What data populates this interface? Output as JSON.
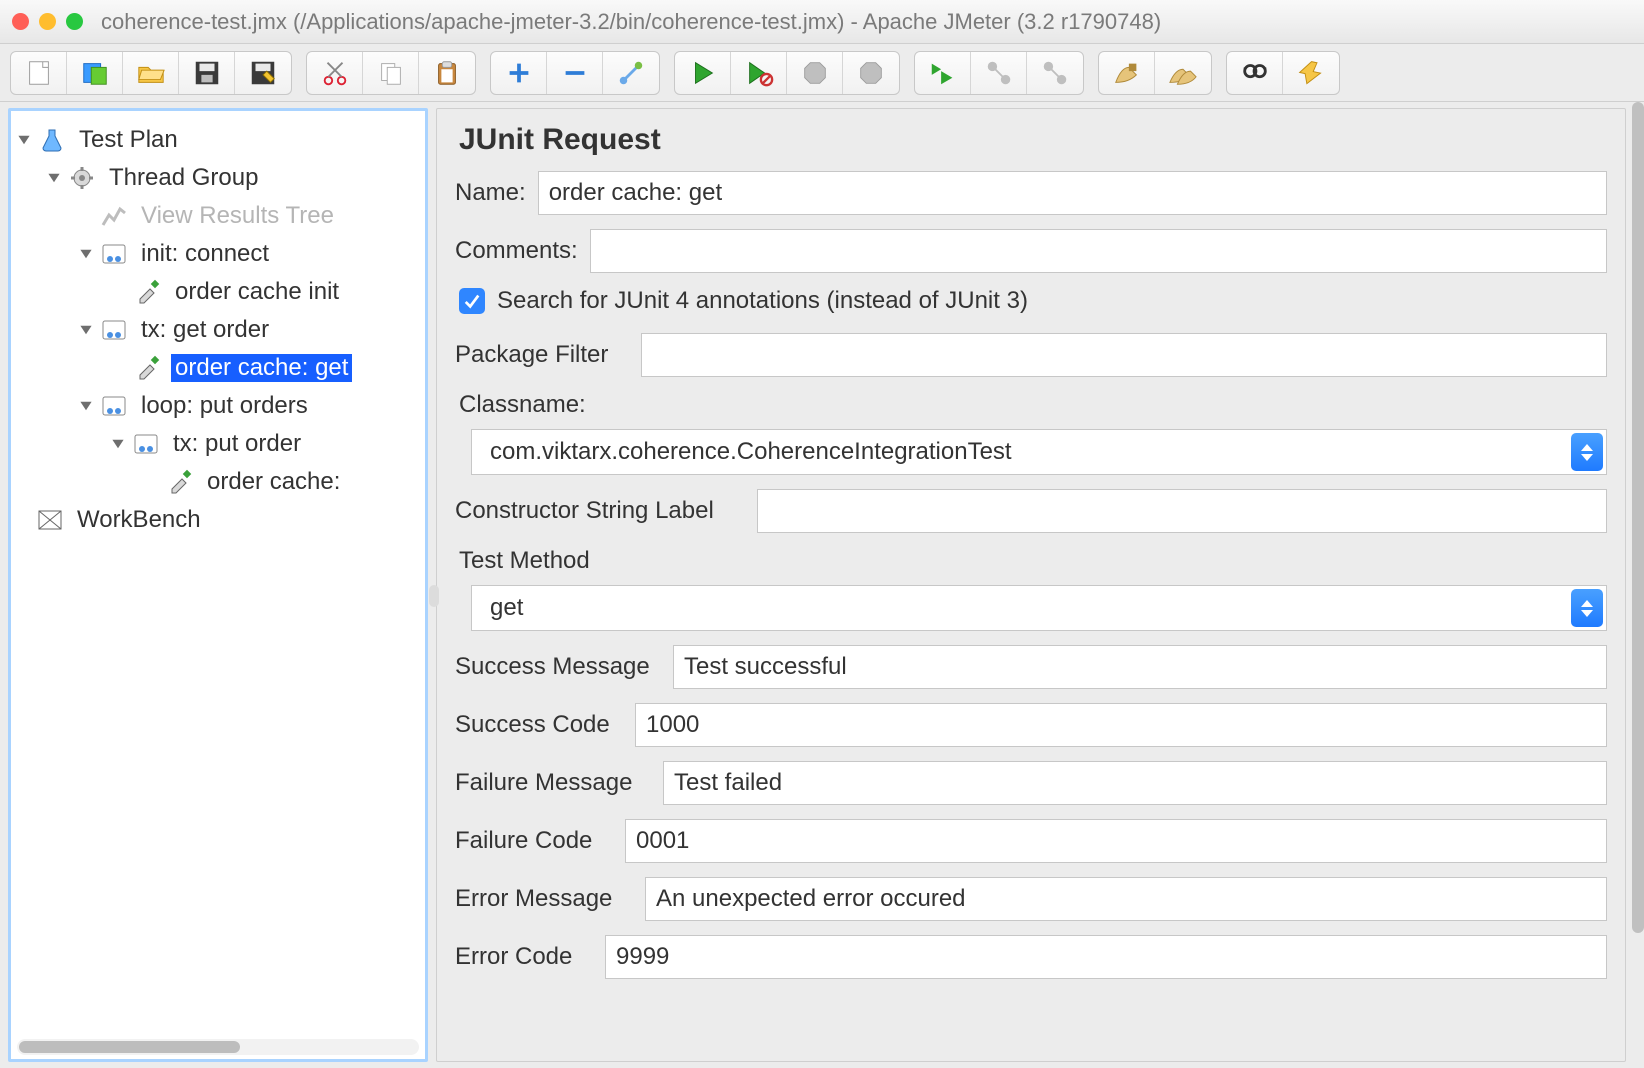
{
  "window": {
    "title": "coherence-test.jmx (/Applications/apache-jmeter-3.2/bin/coherence-test.jmx) - Apache JMeter (3.2 r1790748)"
  },
  "tree": {
    "test_plan": "Test Plan",
    "thread_group": "Thread Group",
    "view_results": "View Results Tree",
    "init_connect": "init: connect",
    "order_cache_init": "order cache init",
    "tx_get_order": "tx: get order",
    "order_cache_get": "order cache: get",
    "loop_put_orders": "loop: put orders",
    "tx_put_order": "tx: put order",
    "order_cache_put": "order cache:",
    "workbench": "WorkBench"
  },
  "panel": {
    "title": "JUnit Request",
    "name_label": "Name:",
    "name_value": "order cache: get",
    "comments_label": "Comments:",
    "comments_value": "",
    "search_annotations": "Search for JUnit 4 annotations (instead of JUnit 3)",
    "package_filter_label": "Package Filter",
    "package_filter_value": "",
    "classname_label": "Classname:",
    "classname_value": "com.viktarx.coherence.CoherenceIntegrationTest",
    "constructor_label": "Constructor String Label",
    "constructor_value": "",
    "test_method_label": "Test Method",
    "test_method_value": "get",
    "success_message_label": "Success Message",
    "success_message_value": "Test successful",
    "success_code_label": "Success Code",
    "success_code_value": "1000",
    "failure_message_label": "Failure Message",
    "failure_message_value": "Test failed",
    "failure_code_label": "Failure Code",
    "failure_code_value": "0001",
    "error_message_label": "Error Message",
    "error_message_value": "An unexpected error occured",
    "error_code_label": "Error Code",
    "error_code_value": "9999"
  }
}
